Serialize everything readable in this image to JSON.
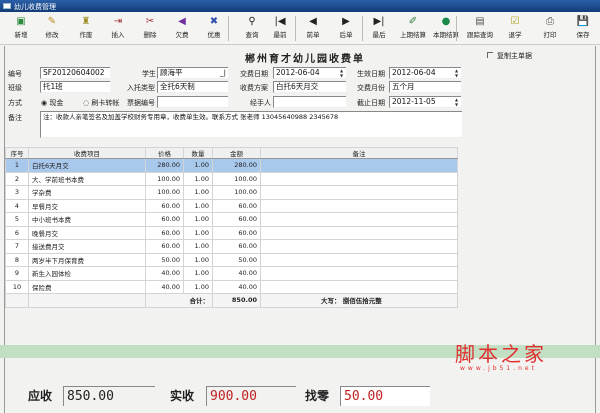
{
  "window": {
    "title": "幼儿收费管理"
  },
  "toolbar": [
    {
      "label": "新增",
      "icon": "add-icon",
      "g": "▣",
      "c": "#2a8a3a"
    },
    {
      "label": "修改",
      "icon": "edit-icon",
      "g": "✎",
      "c": "#c08a20"
    },
    {
      "label": "作废",
      "icon": "void-icon",
      "g": "♜",
      "c": "#9a8a20"
    },
    {
      "label": "插入",
      "icon": "insert-icon",
      "g": "⇥",
      "c": "#a03030"
    },
    {
      "label": "删除",
      "icon": "delete-icon",
      "g": "✂",
      "c": "#a03030"
    },
    {
      "label": "欠费",
      "icon": "arrears-icon",
      "g": "◀",
      "c": "#7030a0"
    },
    {
      "label": "优惠",
      "icon": "discount-icon",
      "g": "✖",
      "c": "#3050b0"
    },
    {
      "label": "查询",
      "icon": "binoculars-icon",
      "g": "⚲",
      "c": "#222"
    },
    {
      "label": "最前",
      "icon": "first-icon",
      "g": "|◀",
      "c": "#222"
    },
    {
      "label": "前单",
      "icon": "prev-icon",
      "g": "◀",
      "c": "#222"
    },
    {
      "label": "后单",
      "icon": "next-icon",
      "g": "▶",
      "c": "#222"
    },
    {
      "label": "最后",
      "icon": "last-icon",
      "g": "▶|",
      "c": "#222"
    },
    {
      "label": "上期结算",
      "icon": "prev-settle-icon",
      "g": "✐",
      "c": "#2a7a3a"
    },
    {
      "label": "本期结算",
      "icon": "settle-icon",
      "g": "●",
      "c": "#1a8a4a"
    },
    {
      "label": "跟踪查询",
      "icon": "track-icon",
      "g": "▤",
      "c": "#555"
    },
    {
      "label": "退学",
      "icon": "withdraw-icon",
      "g": "☑",
      "c": "#b0a020"
    },
    {
      "label": "打印",
      "icon": "print-icon",
      "g": "⎙",
      "c": "#555"
    },
    {
      "label": "保存",
      "icon": "save-icon",
      "g": "💾",
      "c": "#333"
    }
  ],
  "form": {
    "title": "郴州育才幼儿园收费单",
    "copy_label": "复制主单据",
    "id_label": "编号",
    "id": "SF20120604002",
    "student_label": "学生",
    "student": "顾海平",
    "paydate_label": "交费日期",
    "paydate": "2012-06-04",
    "effdate_label": "生效日期",
    "effdate": "2012-06-04",
    "class_label": "班级",
    "class": "托1班",
    "type_label": "入托类型",
    "type": "全托6天制",
    "plan_label": "收费方案",
    "plan": "白托6天月交",
    "months_label": "交费月份",
    "months": "五个月",
    "method_label": "方式",
    "cash": "现金",
    "card": "刷卡转帐",
    "receipt_label": "票据编号",
    "receipt": "",
    "handler_label": "经手人",
    "handler": "",
    "enddate_label": "截止日期",
    "enddate": "2012-11-05",
    "remark_label": "备注",
    "remark": "注：收款人亲笔签名及加盖学校财务专用章，收费单生效。联系方式 张老师 13045640988 2345678"
  },
  "table": {
    "headers": [
      "序号",
      "收费项目",
      "价格",
      "数量",
      "金额",
      "备注"
    ],
    "rows": [
      [
        "1",
        "白托6天月交",
        "280.00",
        "1.00",
        "280.00",
        ""
      ],
      [
        "2",
        "大、学前班书本费",
        "100.00",
        "1.00",
        "100.00",
        ""
      ],
      [
        "3",
        "学杂费",
        "100.00",
        "1.00",
        "100.00",
        ""
      ],
      [
        "4",
        "早餐月交",
        "60.00",
        "1.00",
        "60.00",
        ""
      ],
      [
        "5",
        "中小班书本费",
        "60.00",
        "1.00",
        "60.00",
        ""
      ],
      [
        "6",
        "晚餐月交",
        "60.00",
        "1.00",
        "60.00",
        ""
      ],
      [
        "7",
        "接送费月交",
        "60.00",
        "1.00",
        "60.00",
        ""
      ],
      [
        "8",
        "两岁半下月保育费",
        "50.00",
        "1.00",
        "50.00",
        ""
      ],
      [
        "9",
        "新生入园体检",
        "40.00",
        "1.00",
        "40.00",
        ""
      ],
      [
        "10",
        "保险费",
        "40.00",
        "1.00",
        "40.00",
        ""
      ]
    ],
    "total_label": "合计：",
    "total": "850.00",
    "words_label": "大写：",
    "words": "捌佰伍拾元整"
  },
  "summary": {
    "due_label": "应收",
    "due": "850.00",
    "paid_label": "实收",
    "paid": "900.00",
    "change_label": "找零",
    "change": "50.00"
  },
  "watermark": {
    "text": "脚本之家",
    "url": "www.jb51.net"
  }
}
